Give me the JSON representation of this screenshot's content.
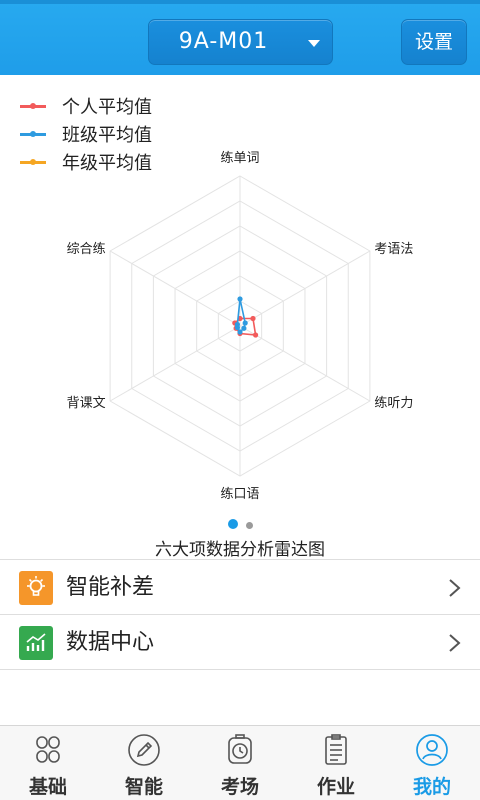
{
  "header": {
    "class_select_value": "9A-M01",
    "settings_label": "设置"
  },
  "chart_data": {
    "type": "radar",
    "axes": [
      "练单词",
      "考语法",
      "练听力",
      "练口语",
      "背课文",
      "综合练"
    ],
    "series": [
      {
        "name": "个人平均值",
        "color": "#f25b5b",
        "values": [
          0.05,
          0.1,
          0.12,
          0.05,
          0.03,
          0.04
        ]
      },
      {
        "name": "班级平均值",
        "color": "#2e9be0",
        "values": [
          0.18,
          0.04,
          0.03,
          0.04,
          0.02,
          0.02
        ]
      },
      {
        "name": "年级平均值",
        "color": "#f5a623",
        "values": [
          0,
          0,
          0,
          0,
          0,
          0
        ]
      }
    ],
    "rings": 6,
    "caption": "六大项数据分析雷达图",
    "legend_position": "top-left",
    "page_dots": {
      "count": 2,
      "active": 0
    }
  },
  "menu": {
    "items": [
      {
        "label": "智能补差",
        "icon": "lightbulb-icon",
        "color": "#f5962a"
      },
      {
        "label": "数据中心",
        "icon": "chart-icon",
        "color": "#35a94f"
      }
    ]
  },
  "bottom_nav": {
    "items": [
      {
        "label": "基础",
        "icon": "grid-icon"
      },
      {
        "label": "智能",
        "icon": "pencil-icon"
      },
      {
        "label": "考场",
        "icon": "clock-icon"
      },
      {
        "label": "作业",
        "icon": "list-icon"
      },
      {
        "label": "我的",
        "icon": "user-icon"
      }
    ],
    "active_index": 4,
    "active_color": "#1a9be6"
  }
}
